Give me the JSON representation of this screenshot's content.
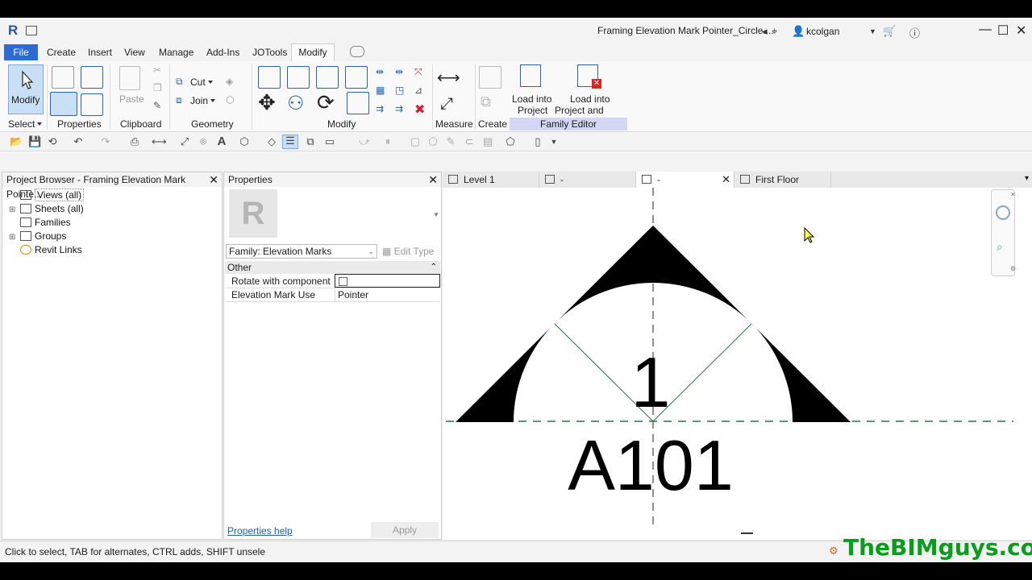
{
  "title_bar": {
    "app_logo": "R",
    "document_title": "Framing Elevation Mark Pointer_Circle....",
    "username": "kcolgan"
  },
  "menu_tabs": [
    "File",
    "Create",
    "Insert",
    "View",
    "Manage",
    "Add-Ins",
    "JOTools",
    "Modify"
  ],
  "ribbon": {
    "modify_label": "Modify",
    "cut_label": "Cut",
    "join_label": "Join",
    "paste_label": "Paste",
    "load_into_project": "Load into Project",
    "load_into_project_line1": "Load into",
    "load_into_project_line2": "Project",
    "load_close_line1": "Load into",
    "load_close_line2": "Project and Close",
    "panels": {
      "select": "Select",
      "properties": "Properties",
      "clipboard": "Clipboard",
      "geometry": "Geometry",
      "modify": "Modify",
      "measure": "Measure",
      "create": "Create",
      "family_editor": "Family Editor"
    }
  },
  "project_browser": {
    "title": "Project Browser - Framing Elevation Mark Pointe...",
    "items": [
      "Views (all)",
      "Sheets (all)",
      "Families",
      "Groups",
      "Revit Links"
    ]
  },
  "properties": {
    "title": "Properties",
    "type_image_letter": "R",
    "family_selector": "Family: Elevation Marks",
    "edit_type": "Edit Type",
    "group": "Other",
    "rows": [
      {
        "key": "Rotate with component",
        "value": ""
      },
      {
        "key": "Elevation Mark Use",
        "value": "Pointer"
      }
    ],
    "help_link": "Properties help",
    "apply": "Apply"
  },
  "view_tabs": [
    "Level 1",
    "-",
    "-",
    "First Floor"
  ],
  "canvas": {
    "detail_number": "1",
    "sheet_number": "A101"
  },
  "status_bar": {
    "text": "Click to select, TAB for alternates, CTRL adds, SHIFT unsele"
  },
  "watermark": "TheBIMguys.com",
  "colors": {
    "file_tab": "#2c6ad6",
    "family_editor_band": "#d3d7f3",
    "watermark": "#0a9c1b"
  }
}
